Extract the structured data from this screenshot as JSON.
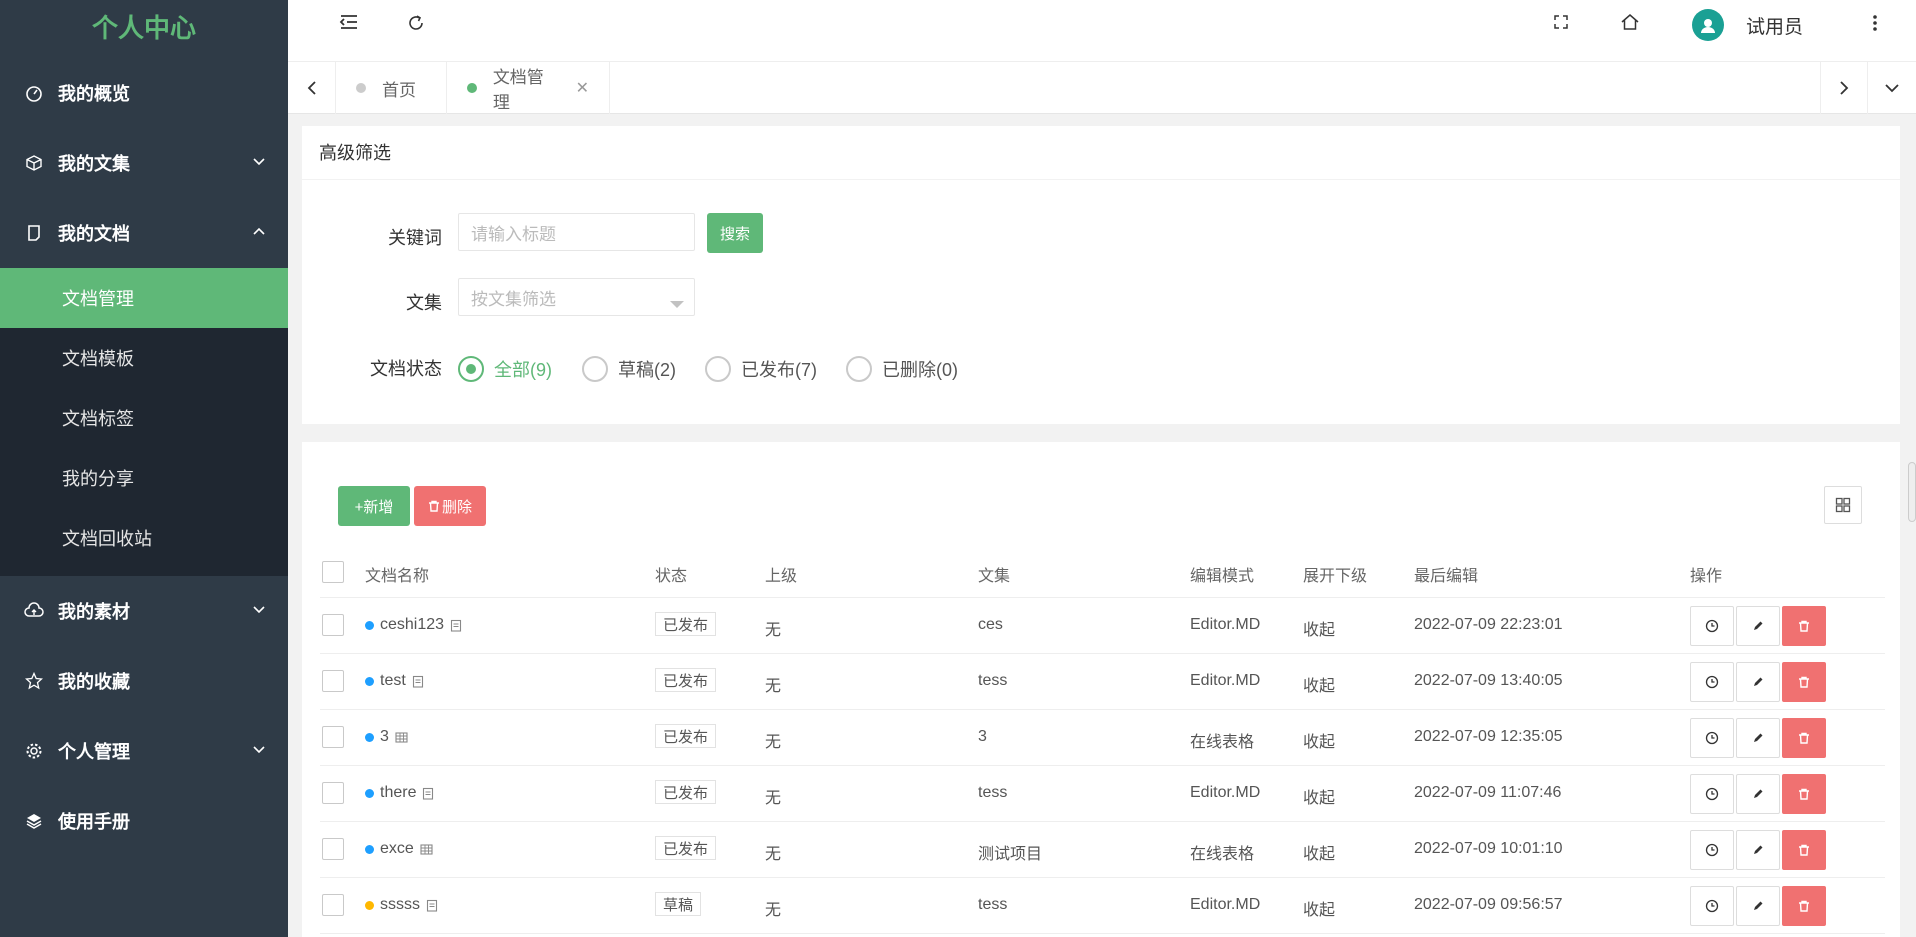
{
  "sidebar": {
    "title": "个人中心",
    "menu": [
      {
        "label": "我的概览",
        "icon": "dashboard-icon"
      },
      {
        "label": "我的文集",
        "icon": "cube-icon"
      },
      {
        "label": "我的文档",
        "icon": "document-icon"
      },
      {
        "label": "我的素材",
        "icon": "cloud-upload-icon"
      },
      {
        "label": "我的收藏",
        "icon": "star-icon"
      },
      {
        "label": "个人管理",
        "icon": "gear-icon"
      },
      {
        "label": "使用手册",
        "icon": "layers-icon"
      }
    ],
    "submenu": [
      "文档管理",
      "文档模板",
      "文档标签",
      "我的分享",
      "文档回收站"
    ]
  },
  "header": {
    "user_name": "试用员"
  },
  "tabs": [
    {
      "label": "首页"
    },
    {
      "label": "文档管理"
    }
  ],
  "filter": {
    "heading": "高级筛选",
    "keyword_label": "关键词",
    "keyword_placeholder": "请输入标题",
    "search_button": "搜索",
    "collection_label": "文集",
    "collection_placeholder": "按文集筛选",
    "status_label": "文档状态",
    "status_options": [
      "全部(9)",
      "草稿(2)",
      "已发布(7)",
      "已删除(0)"
    ],
    "status_selected": "全部(9)"
  },
  "toolbar": {
    "add_label": "+新增",
    "delete_label": "删除"
  },
  "table": {
    "columns": [
      "文档名称",
      "状态",
      "上级",
      "文集",
      "编辑模式",
      "展开下级",
      "最后编辑",
      "操作"
    ],
    "rows": [
      {
        "name": "ceshi123",
        "status": "已发布",
        "parent": "无",
        "collection": "ces",
        "mode": "Editor.MD",
        "expand": "收起",
        "edited": "2022-07-09 22:23:01",
        "dot": "#1e9fff",
        "type_icon": "doc-icon"
      },
      {
        "name": "test",
        "status": "已发布",
        "parent": "无",
        "collection": "tess",
        "mode": "Editor.MD",
        "expand": "收起",
        "edited": "2022-07-09 13:40:05",
        "dot": "#1e9fff",
        "type_icon": "doc-icon"
      },
      {
        "name": "3",
        "status": "已发布",
        "parent": "无",
        "collection": "3",
        "mode": "在线表格",
        "expand": "收起",
        "edited": "2022-07-09 12:35:05",
        "dot": "#1e9fff",
        "type_icon": "table-icon"
      },
      {
        "name": "there",
        "status": "已发布",
        "parent": "无",
        "collection": "tess",
        "mode": "Editor.MD",
        "expand": "收起",
        "edited": "2022-07-09 11:07:46",
        "dot": "#1e9fff",
        "type_icon": "doc-icon"
      },
      {
        "name": "exce",
        "status": "已发布",
        "parent": "无",
        "collection": "测试项目",
        "mode": "在线表格",
        "expand": "收起",
        "edited": "2022-07-09 10:01:10",
        "dot": "#1e9fff",
        "type_icon": "table-icon"
      },
      {
        "name": "sssss",
        "status": "草稿",
        "parent": "无",
        "collection": "tess",
        "mode": "Editor.MD",
        "expand": "收起",
        "edited": "2022-07-09 09:56:57",
        "dot": "#ffb800",
        "type_icon": "doc-icon"
      }
    ]
  },
  "colors": {
    "accent": "#5fb878",
    "danger": "#f07171",
    "sidebar": "#2f3b47",
    "sidebar_sub": "#1f2731"
  }
}
